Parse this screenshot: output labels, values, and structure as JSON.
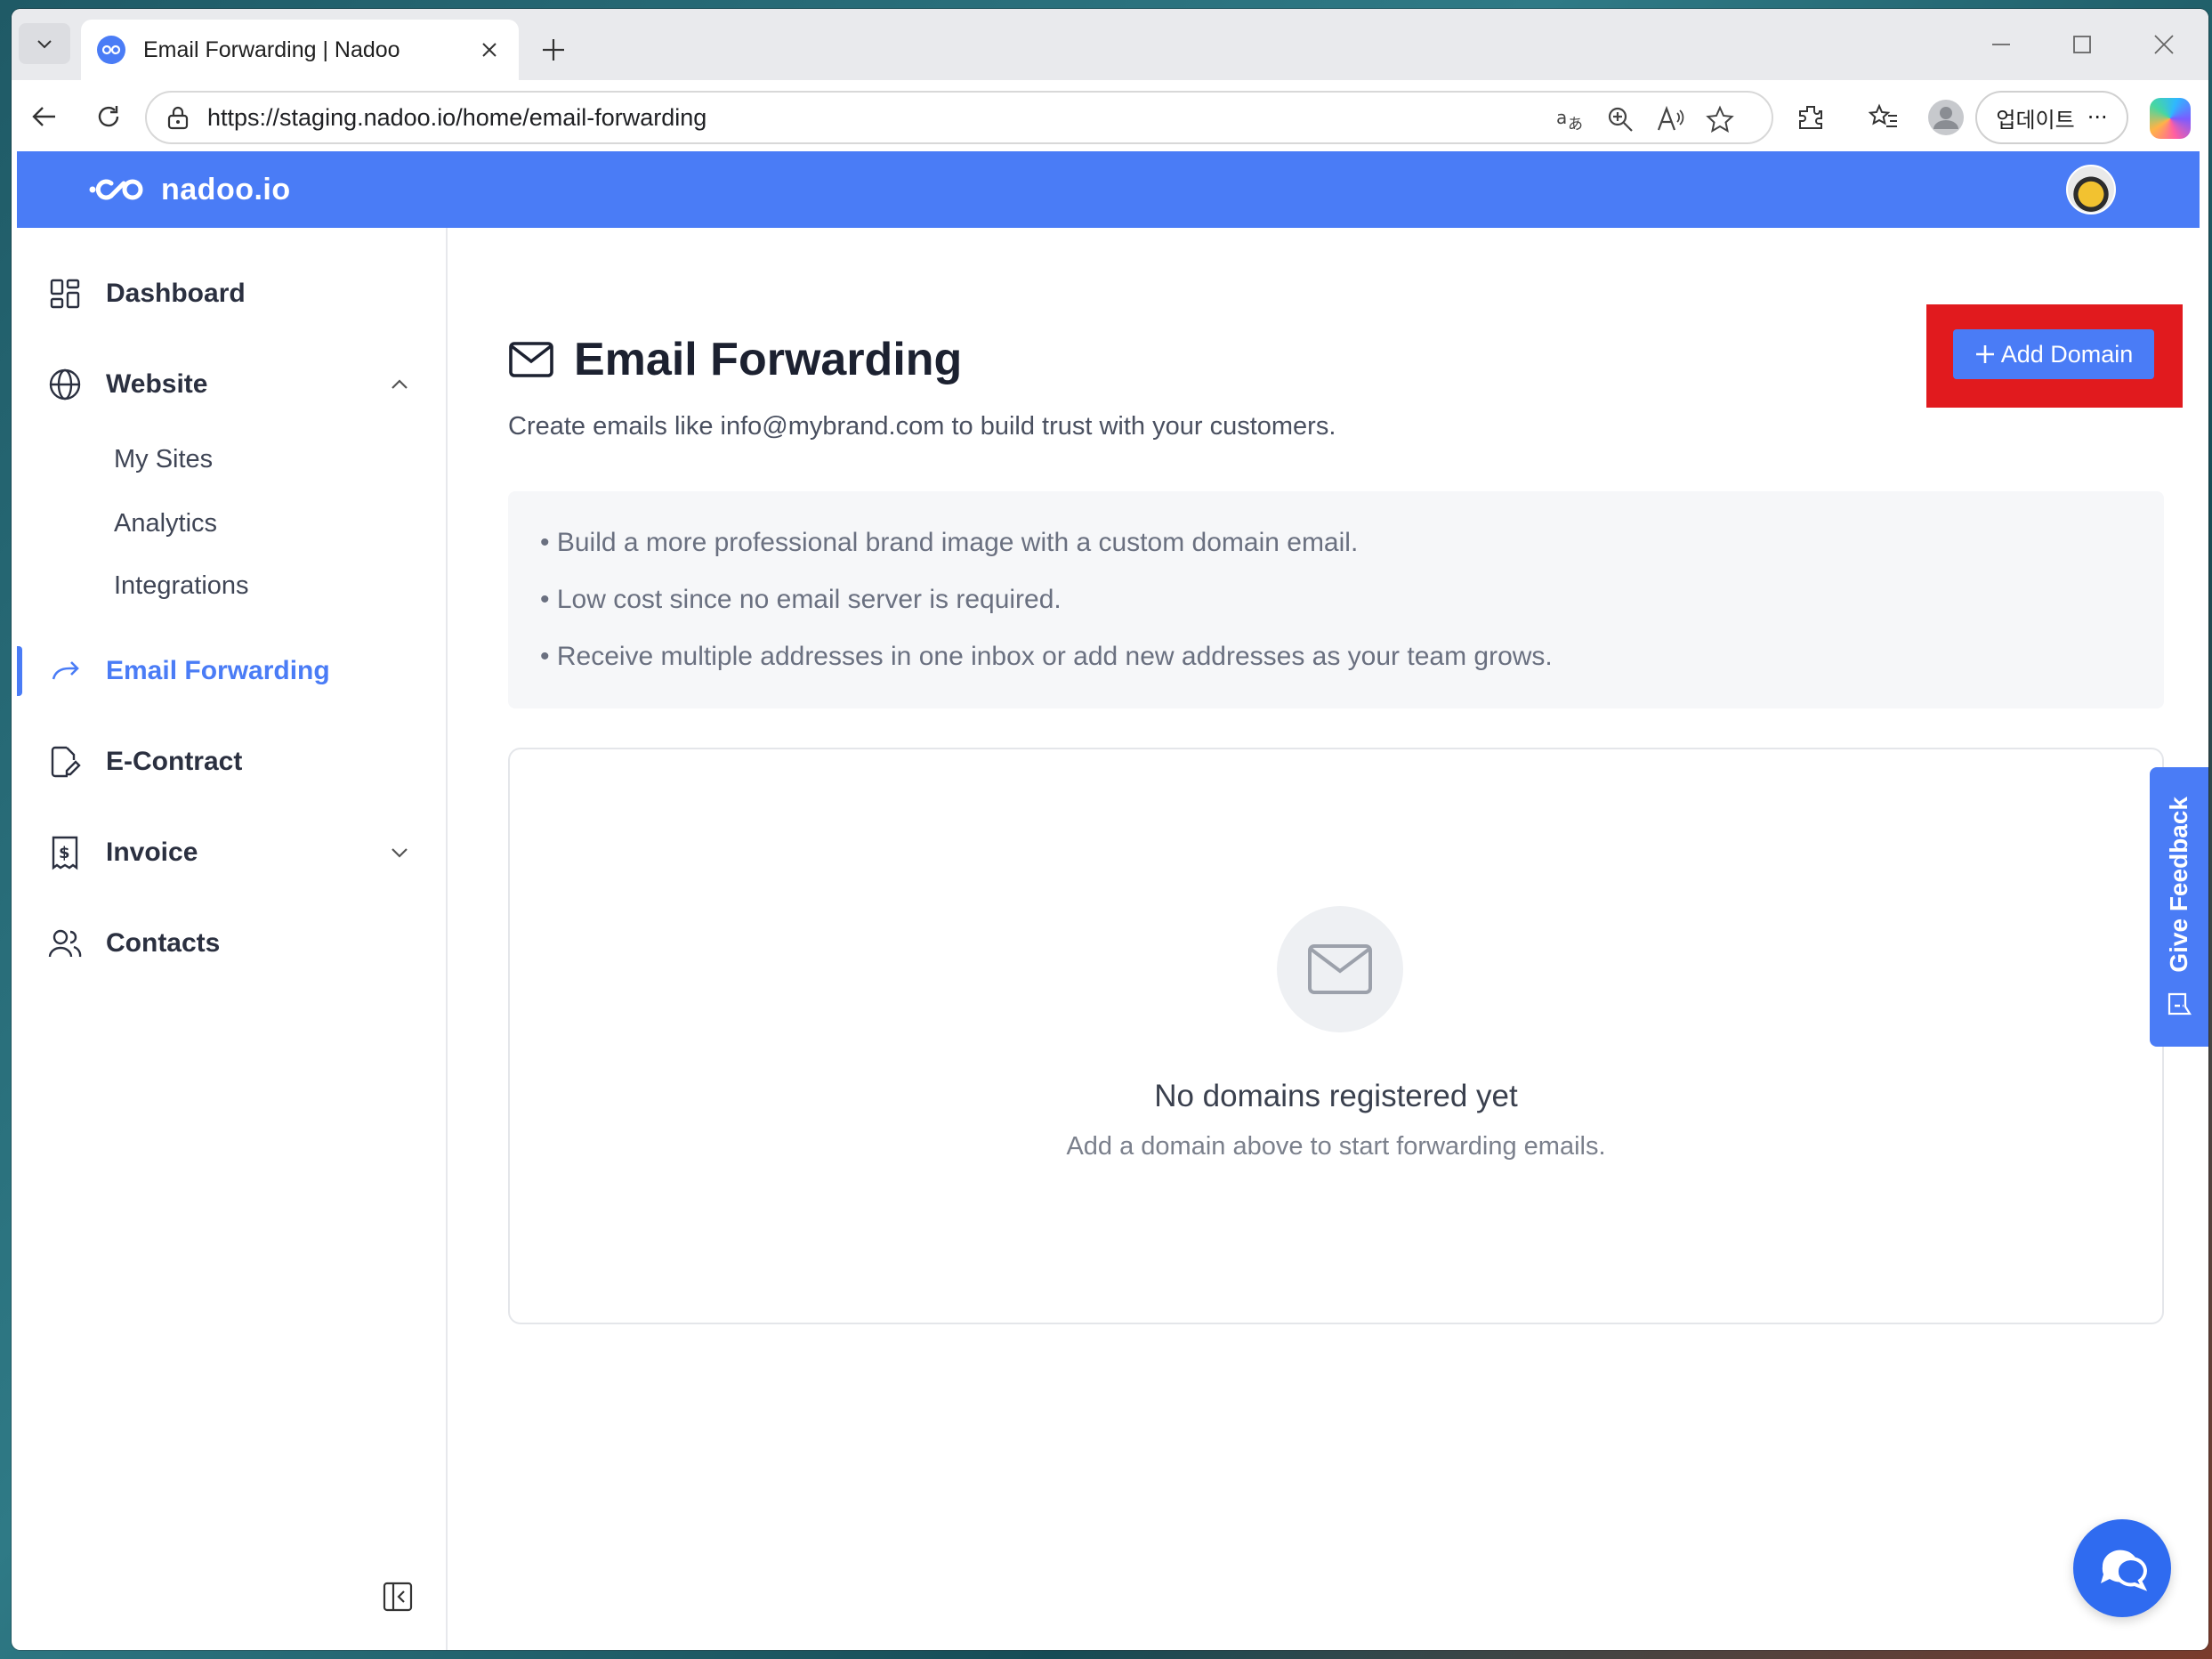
{
  "browser": {
    "tab_title": "Email Forwarding | Nadoo",
    "url": "https://staging.nadoo.io/home/email-forwarding",
    "update_label": "업데이트",
    "more_label": "···"
  },
  "app": {
    "brand": "nadoo.io",
    "accent_color": "#4a7cf6"
  },
  "sidebar": {
    "items": [
      {
        "label": "Dashboard",
        "icon": "dashboard-icon"
      },
      {
        "label": "Website",
        "icon": "globe-icon",
        "expanded": true,
        "children": [
          {
            "label": "My Sites"
          },
          {
            "label": "Analytics"
          },
          {
            "label": "Integrations"
          }
        ]
      },
      {
        "label": "Email Forwarding",
        "icon": "forward-arrow-icon",
        "active": true
      },
      {
        "label": "E-Contract",
        "icon": "contract-icon"
      },
      {
        "label": "Invoice",
        "icon": "invoice-icon",
        "expanded": false
      },
      {
        "label": "Contacts",
        "icon": "contacts-icon"
      }
    ]
  },
  "page": {
    "title": "Email Forwarding",
    "subtitle": "Create emails like info@mybrand.com to build trust with your customers.",
    "add_domain_label": "Add Domain",
    "benefits": [
      "• Build a more professional brand image with a custom domain email.",
      "• Low cost since no email server is required.",
      "• Receive multiple addresses in one inbox or add new addresses as your team grows."
    ],
    "empty_state": {
      "title": "No domains registered yet",
      "message": "Add a domain above to start forwarding emails."
    },
    "feedback_label": "Give Feedback"
  }
}
